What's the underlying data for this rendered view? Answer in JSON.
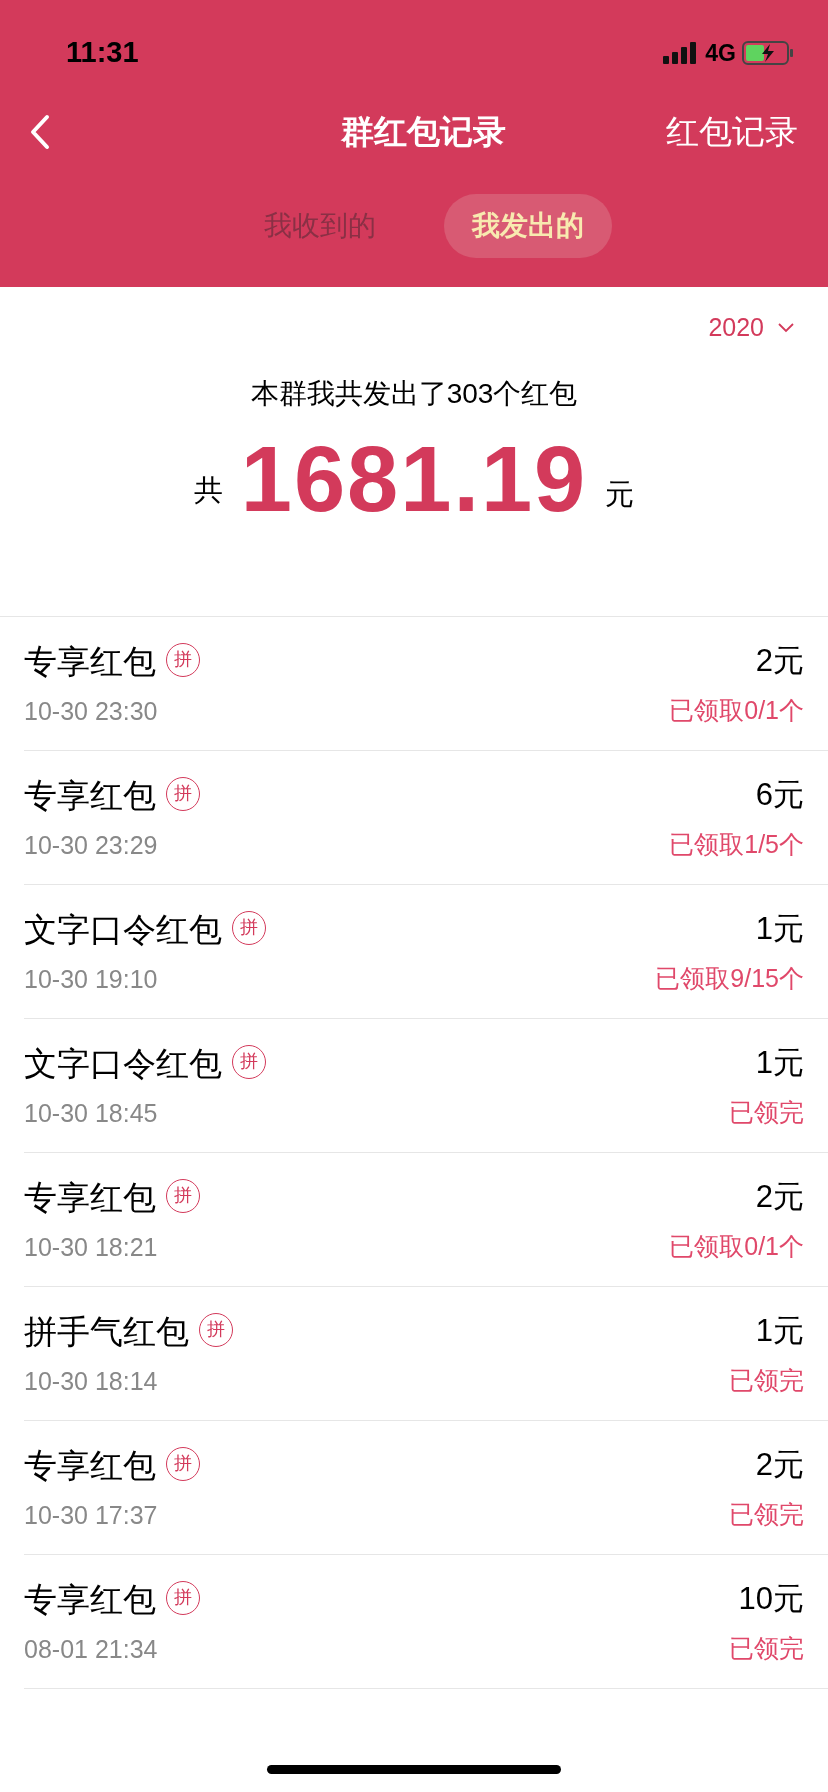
{
  "status_bar": {
    "time": "11:31",
    "network": "4G"
  },
  "nav": {
    "title": "群红包记录",
    "action": "红包记录"
  },
  "tabs": [
    {
      "label": "我收到的",
      "selected": false
    },
    {
      "label": "我发出的",
      "selected": true
    }
  ],
  "year": "2020",
  "summary": "本群我共发出了303个红包",
  "total": {
    "prefix": "共",
    "amount": "1681.19",
    "unit": "元"
  },
  "records": [
    {
      "name": "专享红包",
      "badge": "拼",
      "time": "10-30 23:30",
      "amount": "2元",
      "status": "已领取0/1个"
    },
    {
      "name": "专享红包",
      "badge": "拼",
      "time": "10-30 23:29",
      "amount": "6元",
      "status": "已领取1/5个"
    },
    {
      "name": "文字口令红包",
      "badge": "拼",
      "time": "10-30 19:10",
      "amount": "1元",
      "status": "已领取9/15个"
    },
    {
      "name": "文字口令红包",
      "badge": "拼",
      "time": "10-30 18:45",
      "amount": "1元",
      "status": "已领完"
    },
    {
      "name": "专享红包",
      "badge": "拼",
      "time": "10-30 18:21",
      "amount": "2元",
      "status": "已领取0/1个"
    },
    {
      "name": "拼手气红包",
      "badge": "拼",
      "time": "10-30 18:14",
      "amount": "1元",
      "status": "已领完"
    },
    {
      "name": "专享红包",
      "badge": "拼",
      "time": "10-30 17:37",
      "amount": "2元",
      "status": "已领完"
    },
    {
      "name": "专享红包",
      "badge": "拼",
      "time": "08-01 21:34",
      "amount": "10元",
      "status": "已领完"
    }
  ]
}
